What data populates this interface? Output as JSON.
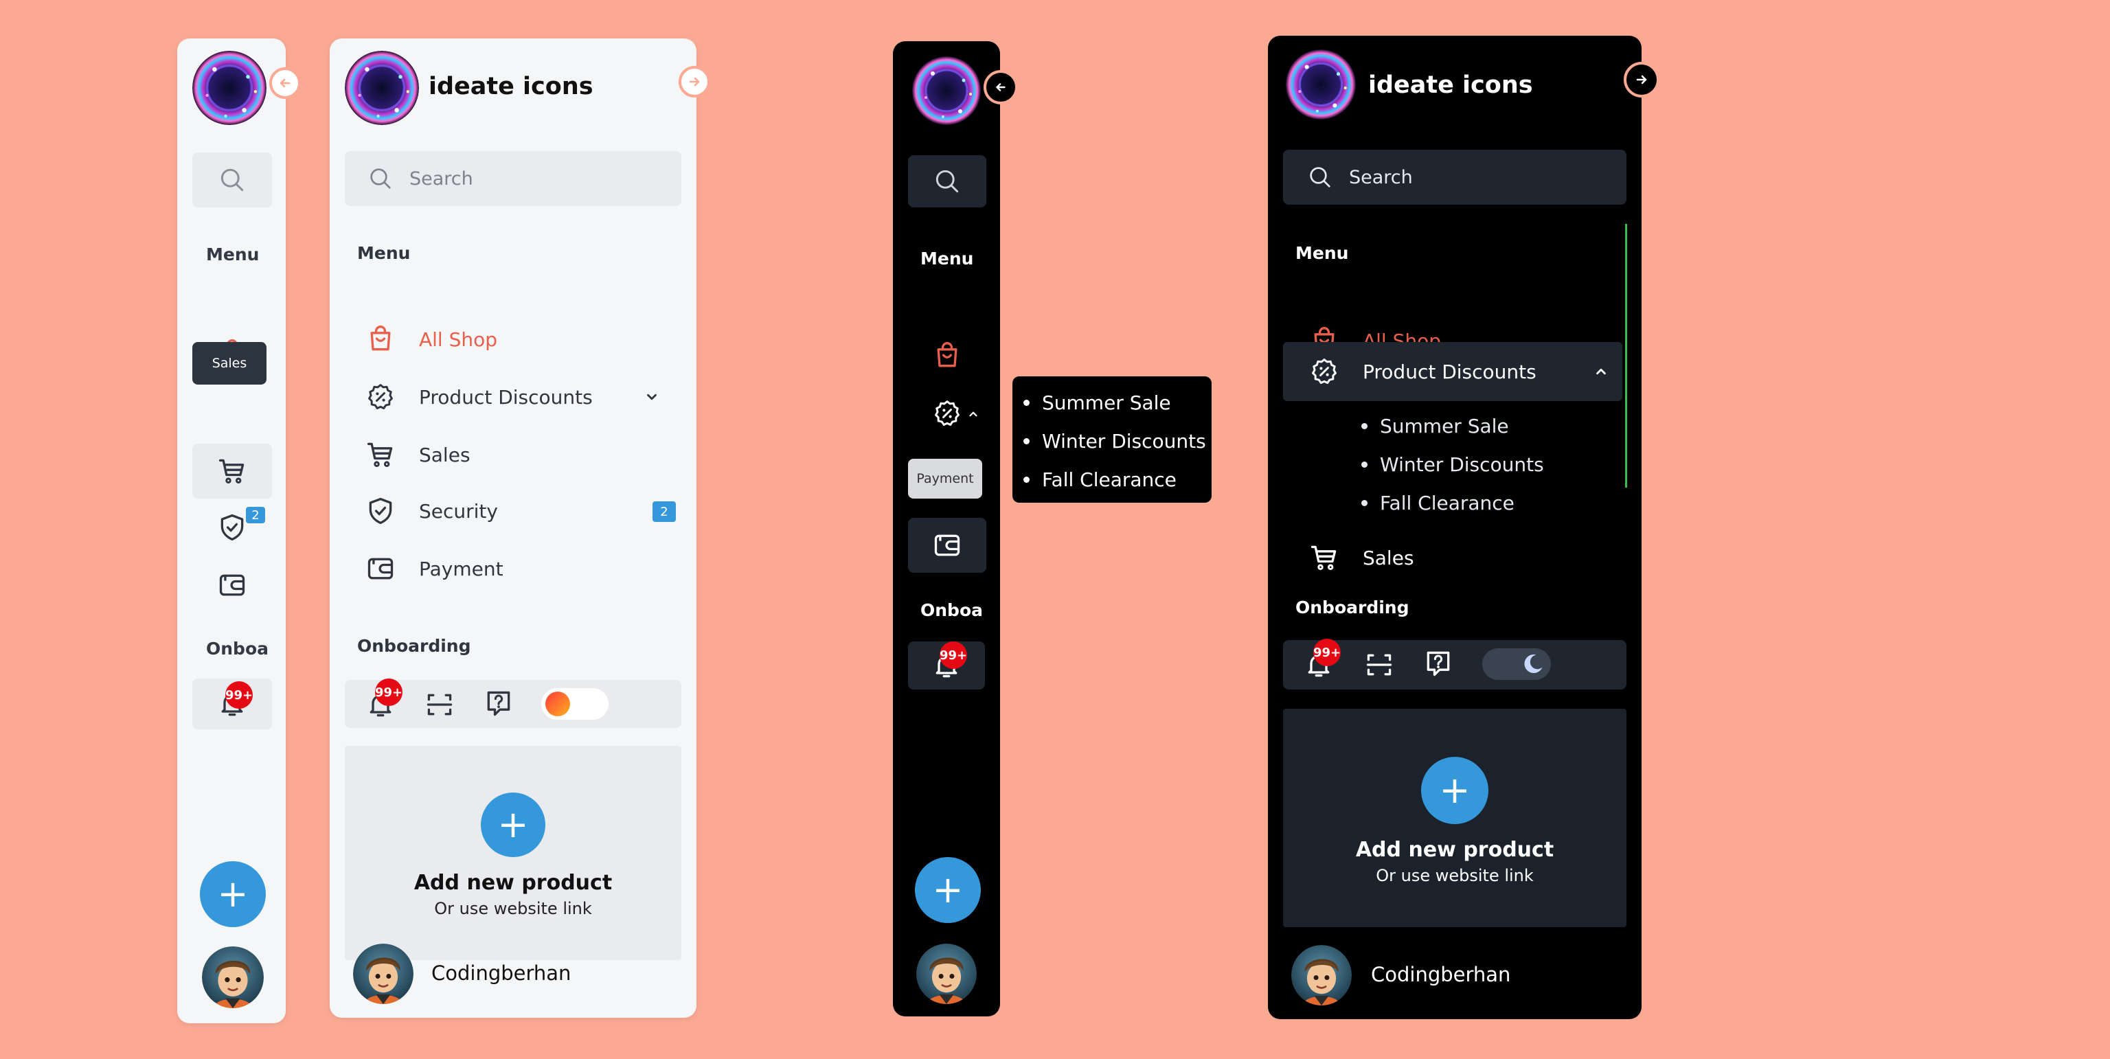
{
  "brand": {
    "name": "ideate icons"
  },
  "search": {
    "placeholder": "Search"
  },
  "sections": {
    "menu": "Menu",
    "onboarding": "Onboarding",
    "onboarding_short": "Onboa"
  },
  "nav": {
    "all_shop": "All Shop",
    "product_discounts": "Product Discounts",
    "sales": "Sales",
    "security": "Security",
    "payment": "Payment"
  },
  "submenu": [
    "Summer Sale",
    "Winter Discounts",
    "Fall Clearance"
  ],
  "badges": {
    "notifications": "99+",
    "security": "2"
  },
  "tooltips": {
    "sales": "Sales",
    "payment": "Payment"
  },
  "add_product": {
    "title": "Add new product",
    "subtitle": "Or use website link",
    "plus": "+"
  },
  "user": {
    "name": "Codingberhan"
  },
  "colors": {
    "background": "#fba992",
    "accent": "#e8604c",
    "primary": "#3498db",
    "dark_panel": "#000000",
    "light_panel": "#f5f6f7",
    "badge_red": "#e50914"
  },
  "icons": [
    "logo-orb",
    "arrow-left-icon",
    "arrow-right-icon",
    "search-icon",
    "shopping-bag-icon",
    "discount-badge-icon",
    "chevron-down-icon",
    "chevron-up-icon",
    "cart-icon",
    "shield-check-icon",
    "wallet-icon",
    "bell-icon",
    "scan-icon",
    "help-icon",
    "theme-toggle"
  ]
}
